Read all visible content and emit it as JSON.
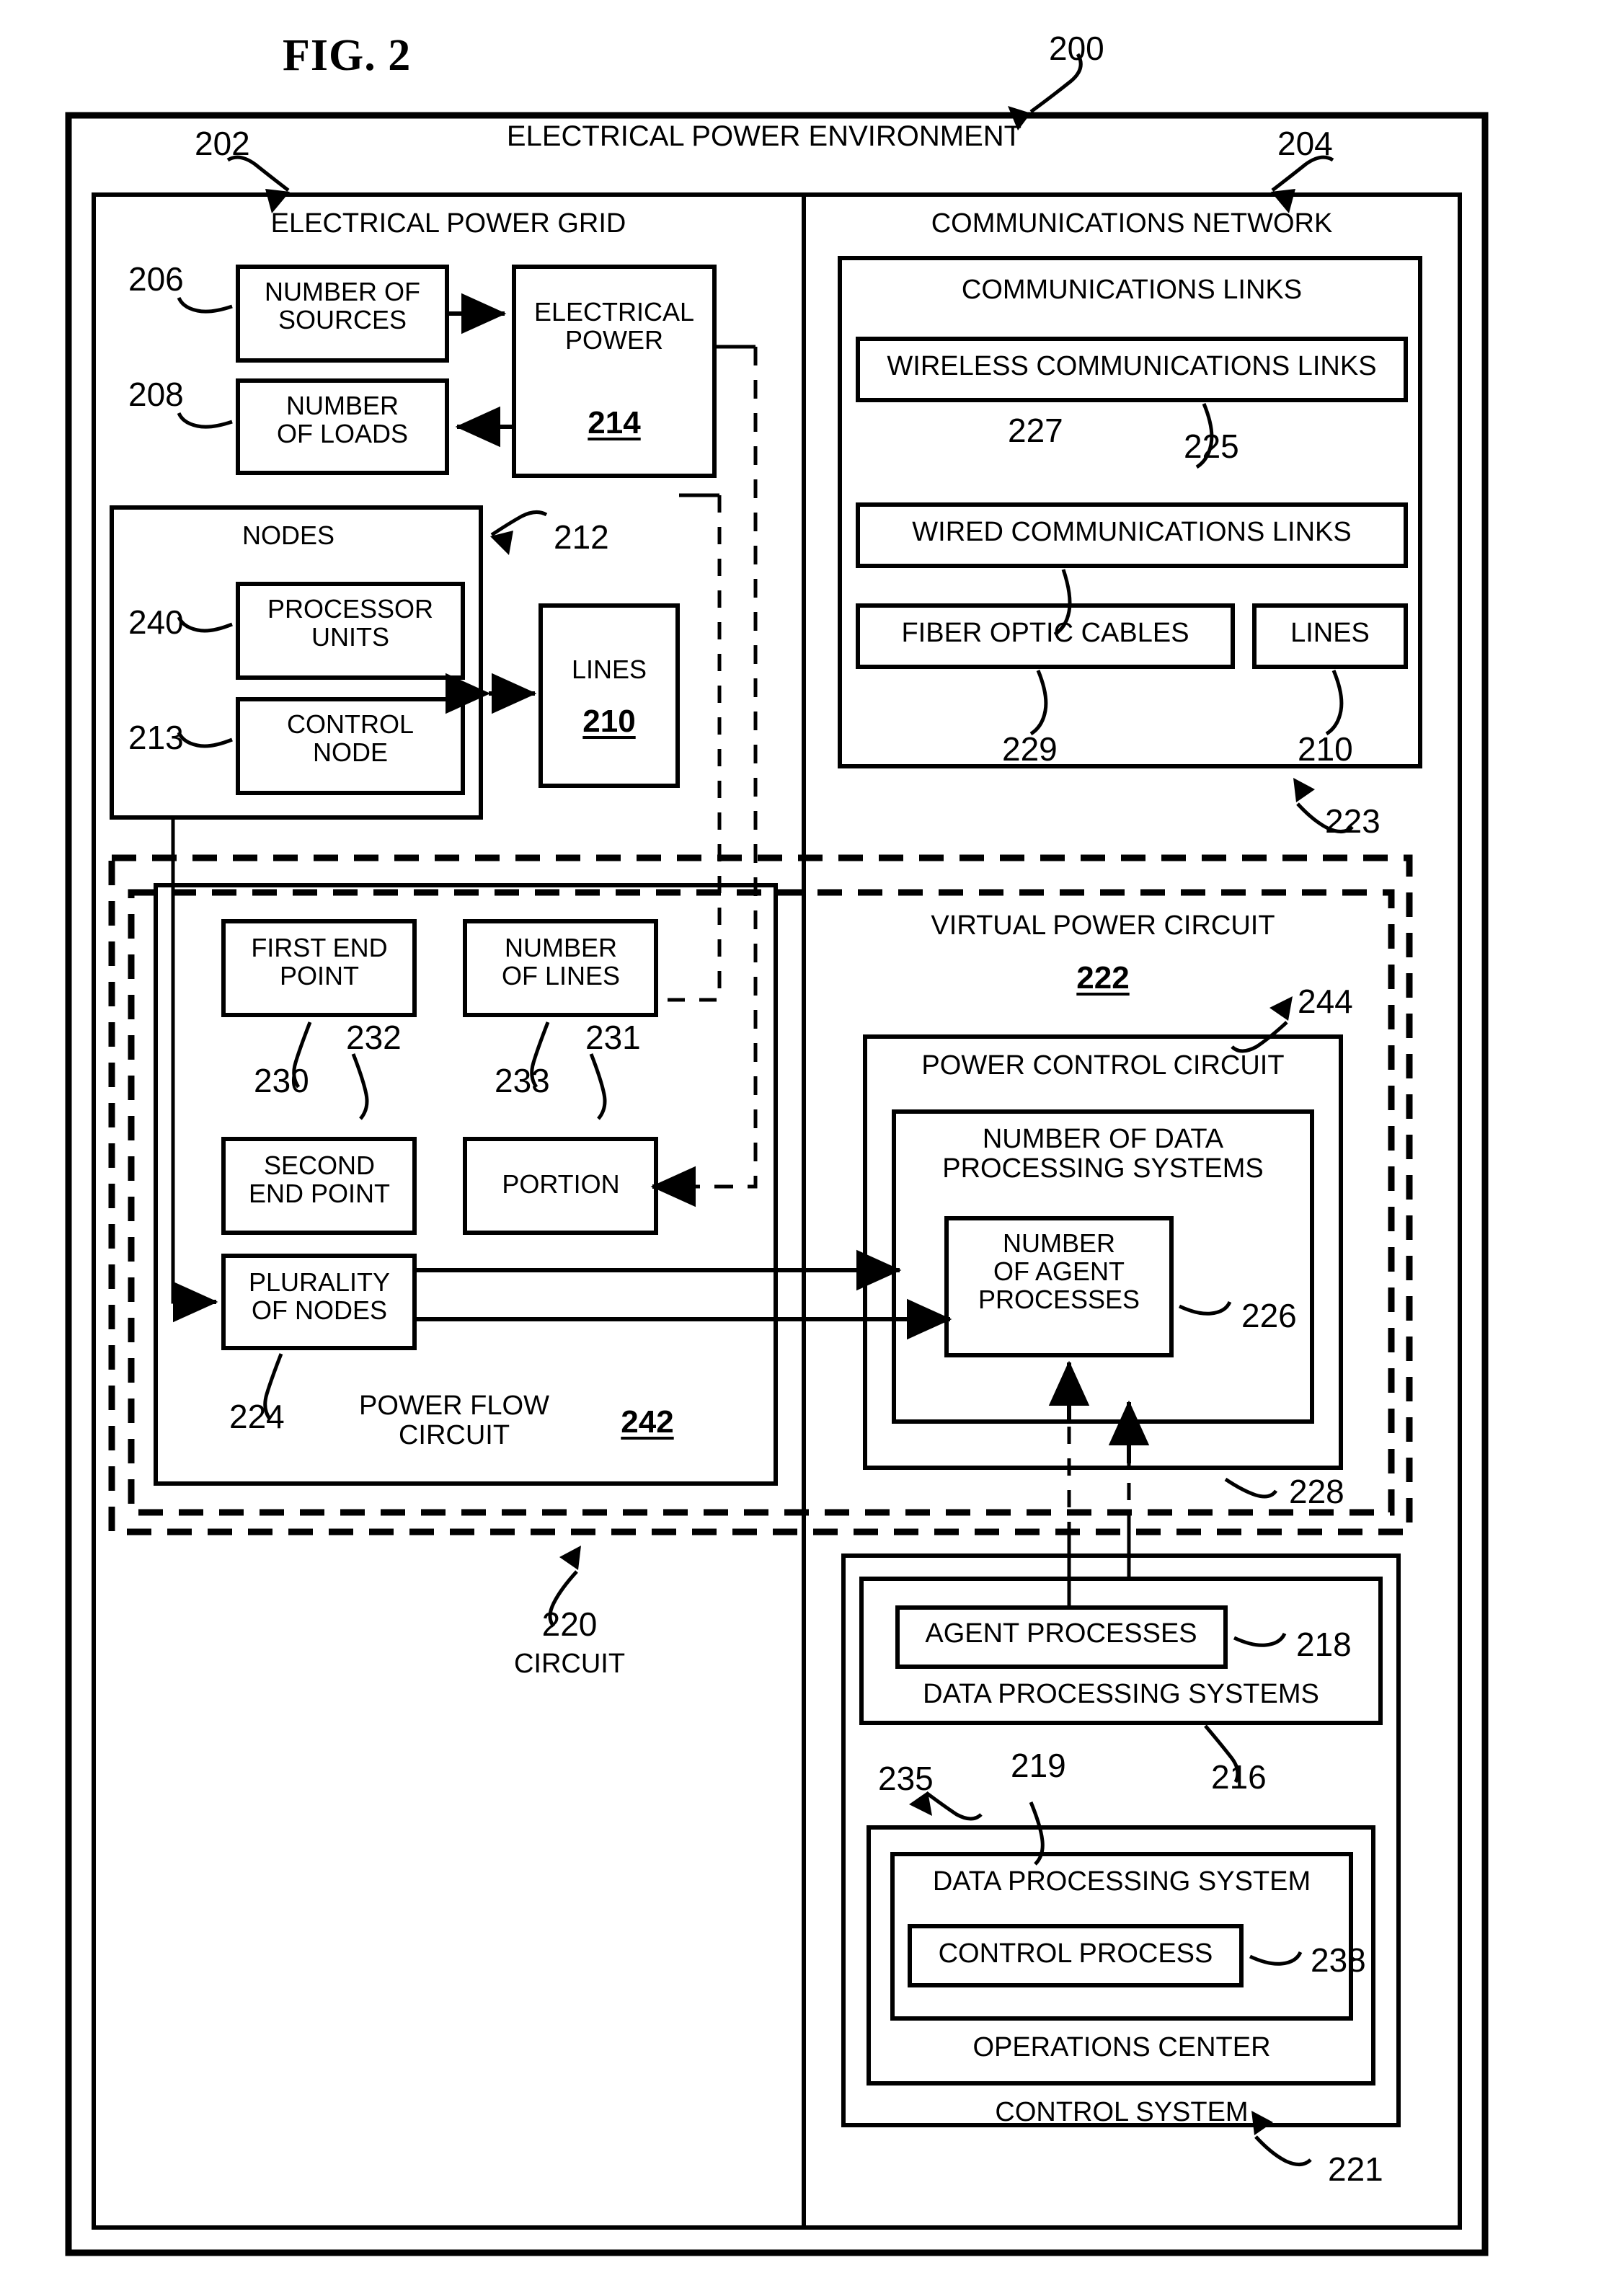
{
  "figure": {
    "title": "FIG. 2",
    "ref": "200"
  },
  "environment": {
    "title": "ELECTRICAL POWER ENVIRONMENT",
    "ref": "200"
  },
  "grid": {
    "title": "ELECTRICAL POWER GRID",
    "ref": "202",
    "sources": {
      "label": "NUMBER OF\nSOURCES",
      "ref": "206"
    },
    "loads": {
      "label": "NUMBER\nOF LOADS",
      "ref": "208"
    },
    "electrical_power": {
      "label": "ELECTRICAL\nPOWER",
      "ref": "214"
    },
    "nodes": {
      "label": "NODES",
      "ref": "212"
    },
    "processor_units": {
      "label": "PROCESSOR\nUNITS",
      "ref": "240"
    },
    "control_node": {
      "label": "CONTROL\nNODE",
      "ref": "213"
    },
    "lines": {
      "label": "LINES",
      "ref": "210"
    }
  },
  "comms": {
    "title": "COMMUNICATIONS NETWORK",
    "ref": "204",
    "links_title": "COMMUNICATIONS LINKS",
    "links_ref": "223",
    "wireless": {
      "label": "WIRELESS COMMUNICATIONS LINKS",
      "ref": "225"
    },
    "wired": {
      "label": "WIRED COMMUNICATIONS LINKS",
      "ref": "227"
    },
    "fiber": {
      "label": "FIBER OPTIC CABLES",
      "ref": "229"
    },
    "lines": {
      "label": "LINES",
      "ref": "210"
    }
  },
  "circuit": {
    "label": "CIRCUIT",
    "ref": "220"
  },
  "power_flow": {
    "title": "POWER FLOW\nCIRCUIT",
    "ref": "242",
    "first_end_point": {
      "label": "FIRST END\nPOINT",
      "ref": "230"
    },
    "number_of_lines": {
      "label": "NUMBER\nOF LINES",
      "ref": "233"
    },
    "second_end_point": {
      "label": "SECOND\nEND POINT",
      "ref": "232"
    },
    "portion": {
      "label": "PORTION",
      "ref": "231"
    },
    "plurality_of_nodes": {
      "label": "PLURALITY\nOF NODES",
      "ref": "224"
    }
  },
  "virtual_power_circuit": {
    "title": "VIRTUAL POWER CIRCUIT",
    "ref": "222",
    "power_control_circuit": {
      "label": "POWER CONTROL CIRCUIT",
      "ref": "244"
    },
    "number_of_data_processing_systems": {
      "label": "NUMBER OF DATA\nPROCESSING SYSTEMS",
      "ref": "228"
    },
    "number_of_agent_processes": {
      "label": "NUMBER\nOF AGENT\nPROCESSES",
      "ref": "226"
    }
  },
  "control_system": {
    "title": "CONTROL SYSTEM",
    "ref": "221",
    "data_processing_systems": {
      "label": "DATA PROCESSING SYSTEMS",
      "ref": "216"
    },
    "agent_processes": {
      "label": "AGENT PROCESSES",
      "ref": "218"
    },
    "operations_center": {
      "label": "OPERATIONS CENTER",
      "ref": "219"
    },
    "data_processing_system": {
      "label": "DATA PROCESSING SYSTEM",
      "ref": "235"
    },
    "control_process": {
      "label": "CONTROL PROCESS",
      "ref": "238"
    }
  }
}
